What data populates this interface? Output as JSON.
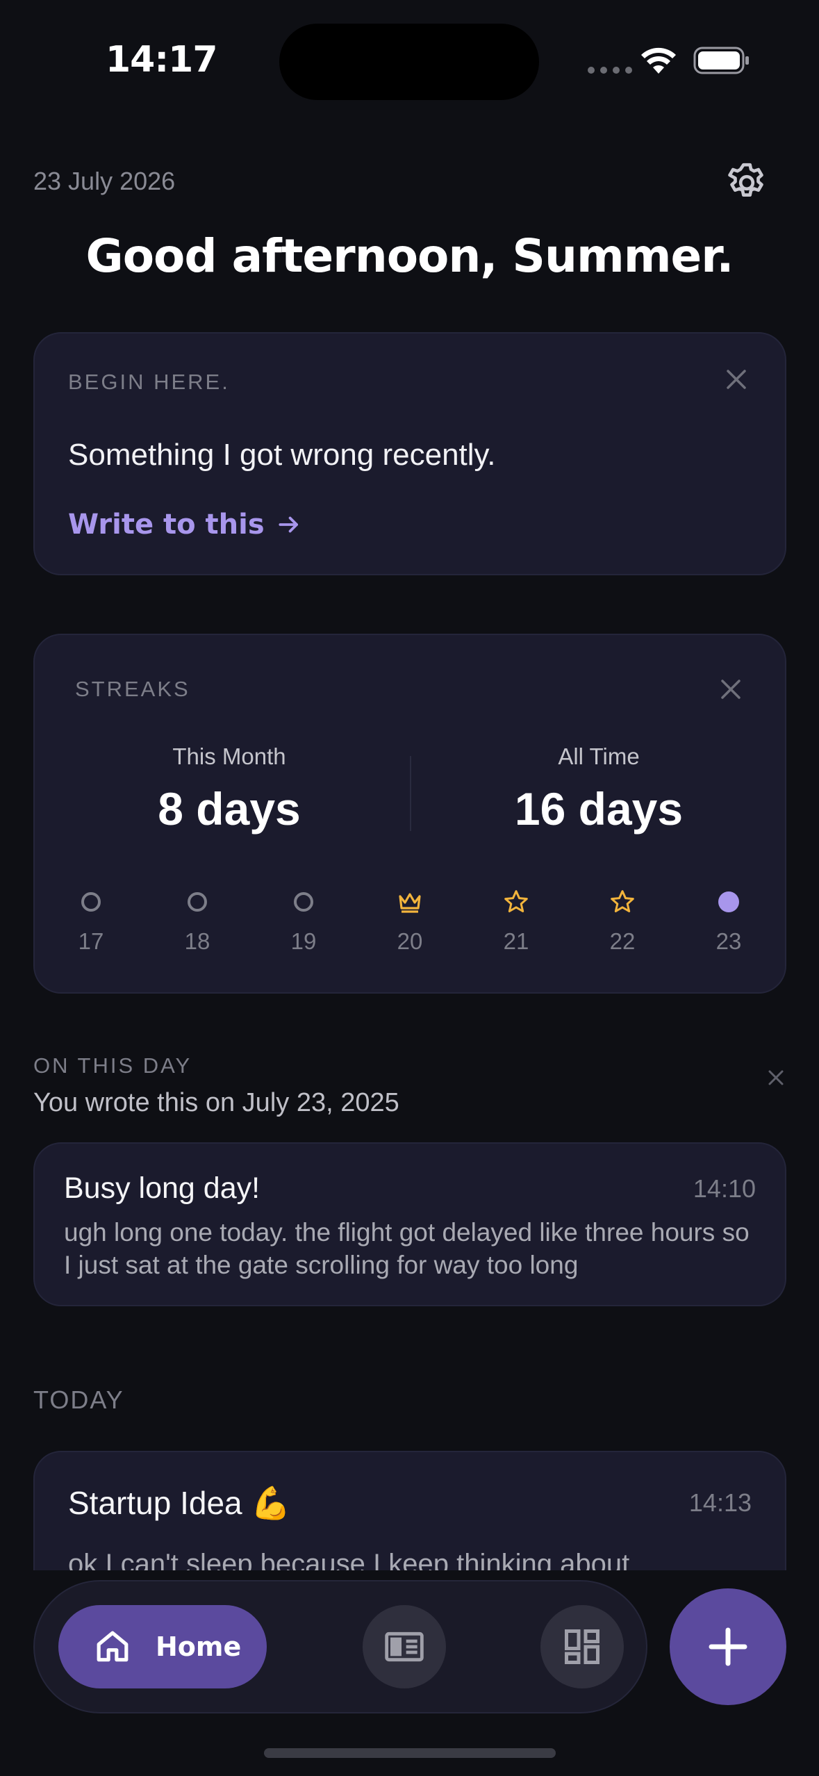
{
  "status_bar": {
    "time": "14:17"
  },
  "header": {
    "date": "23 July 2026",
    "greeting": "Good afternoon, Summer."
  },
  "begin_card": {
    "overline": "BEGIN HERE.",
    "prompt": "Something I got wrong recently.",
    "action_label": "Write to this"
  },
  "streaks": {
    "overline": "STREAKS",
    "this_month": {
      "label": "This Month",
      "value": "8 days"
    },
    "all_time": {
      "label": "All Time",
      "value": "16 days"
    },
    "days": [
      {
        "num": "17",
        "status": "empty",
        "icon": "circle-outline-icon"
      },
      {
        "num": "18",
        "status": "empty",
        "icon": "circle-outline-icon"
      },
      {
        "num": "19",
        "status": "empty",
        "icon": "circle-outline-icon"
      },
      {
        "num": "20",
        "status": "crown",
        "icon": "crown-icon"
      },
      {
        "num": "21",
        "status": "star",
        "icon": "star-icon"
      },
      {
        "num": "22",
        "status": "star",
        "icon": "star-icon"
      },
      {
        "num": "23",
        "status": "today",
        "icon": "filled-dot-icon"
      }
    ]
  },
  "on_this_day": {
    "title": "ON THIS DAY",
    "subtitle": "You wrote this on July 23, 2025",
    "entry": {
      "title": "Busy long day!",
      "time": "14:10",
      "body": "ugh long one today. the flight got delayed like three hours so I just sat at the gate scrolling for way too long"
    }
  },
  "today": {
    "title": "TODAY",
    "entry": {
      "title": "Startup Idea 💪",
      "time": "14:13",
      "body": "ok I can't sleep because I keep thinking about"
    }
  },
  "nav": {
    "home_label": "Home"
  },
  "colors": {
    "background": "#0e0f14",
    "card": "#1b1b2d",
    "accent": "#5b4a9e",
    "accent_text": "#a896ec",
    "gold": "#f2b43c",
    "today_dot": "#a896ec"
  }
}
